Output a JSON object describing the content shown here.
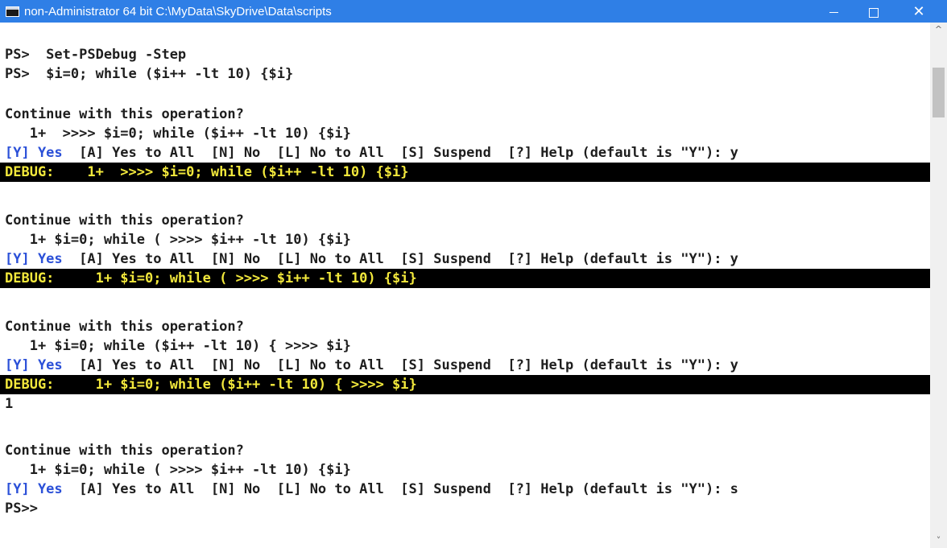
{
  "window": {
    "title": "non-Administrator 64 bit C:\\MyData\\SkyDrive\\Data\\scripts",
    "controls": {
      "minimize_icon": "minimize-icon",
      "maximize_icon": "maximize-icon",
      "close_glyph": "✕"
    }
  },
  "colors": {
    "titlebar": "#2f7fe6",
    "debug_background": "#000000",
    "debug_text": "#f2e83c",
    "yes_choice": "#2b50d8"
  },
  "console": {
    "lines": {
      "l1": "PS>  Set-PSDebug -Step",
      "l2": "PS>  $i=0; while ($i++ -lt 10) {$i}",
      "l3": "Continue with this operation?",
      "l4": "   1+  >>>> $i=0; while ($i++ -lt 10) {$i}",
      "l5_yes": "[Y] Yes",
      "l5_rest": "  [A] Yes to All  [N] No  [L] No to All  [S] Suspend  [?] Help (default is \"Y\"): y",
      "l6_debug": "DEBUG:    1+  >>>> $i=0; while ($i++ -lt 10) {$i}",
      "l7": "Continue with this operation?",
      "l8": "   1+ $i=0; while ( >>>> $i++ -lt 10) {$i}",
      "l9_yes": "[Y] Yes",
      "l9_rest": "  [A] Yes to All  [N] No  [L] No to All  [S] Suspend  [?] Help (default is \"Y\"): y",
      "l10_debug": "DEBUG:     1+ $i=0; while ( >>>> $i++ -lt 10) {$i}",
      "l11": "Continue with this operation?",
      "l12": "   1+ $i=0; while ($i++ -lt 10) { >>>> $i}",
      "l13_yes": "[Y] Yes",
      "l13_rest": "  [A] Yes to All  [N] No  [L] No to All  [S] Suspend  [?] Help (default is \"Y\"): y",
      "l14_debug": "DEBUG:     1+ $i=0; while ($i++ -lt 10) { >>>> $i}",
      "l15": "1",
      "l16": "Continue with this operation?",
      "l17": "   1+ $i=0; while ( >>>> $i++ -lt 10) {$i}",
      "l18_yes": "[Y] Yes",
      "l18_rest": "  [A] Yes to All  [N] No  [L] No to All  [S] Suspend  [?] Help (default is \"Y\"): s",
      "l19": "PS>>"
    }
  },
  "scrollbar": {
    "up_glyph": "^",
    "down_glyph": "˅"
  }
}
